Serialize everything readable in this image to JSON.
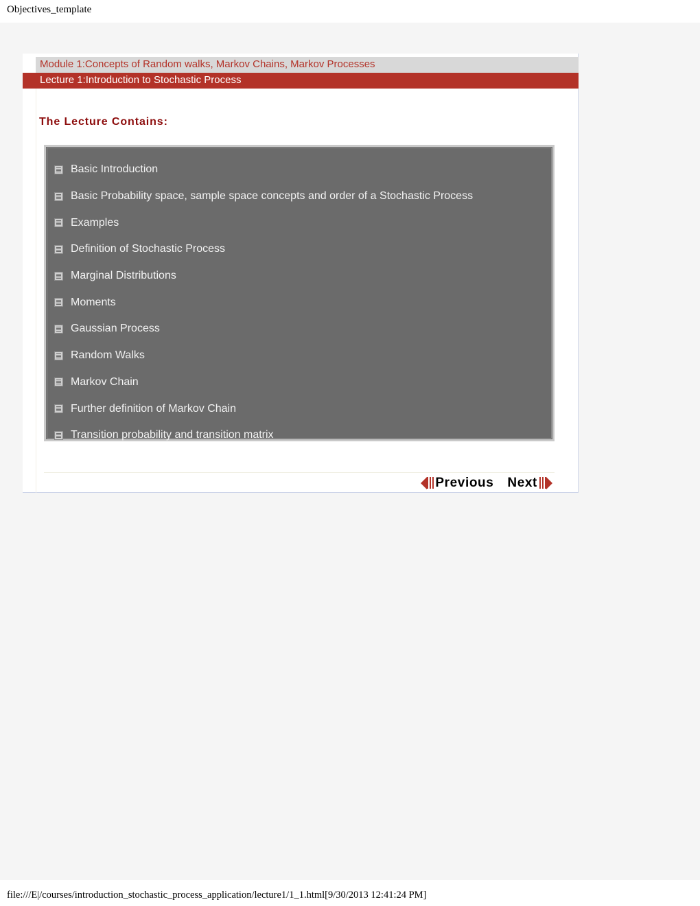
{
  "document": {
    "title": "Objectives_template",
    "footer_path": "file:///E|/courses/introduction_stochastic_process_application/lecture1/1_1.html[9/30/2013 12:41:24 PM]"
  },
  "header": {
    "module": "Module 1:Concepts of Random walks, Markov Chains, Markov Processes",
    "lecture": "Lecture 1:Introduction to Stochastic Process",
    "module_bar_color": "#d8d8d8",
    "module_text_color": "#b33228",
    "lecture_bar_color": "#b33228",
    "lecture_text_color": "#ffffff"
  },
  "content": {
    "heading": "The Lecture Contains:",
    "heading_color": "#8c0b0b",
    "box_bg_color": "#6b6b6b",
    "box_border_color": "#c9c9c9",
    "topics": [
      {
        "label": "Basic Introduction",
        "icon": "document-lines-icon"
      },
      {
        "label": "Basic Probability space, sample space concepts and order of a Stochastic Process",
        "icon": "document-lines-icon"
      },
      {
        "label": "Examples",
        "icon": "document-lines-icon"
      },
      {
        "label": "Definition of Stochastic Process",
        "icon": "document-lines-icon"
      },
      {
        "label": "Marginal Distributions",
        "icon": "document-lines-icon"
      },
      {
        "label": "Moments",
        "icon": "document-lines-icon"
      },
      {
        "label": "Gaussian Process",
        "icon": "document-lines-icon"
      },
      {
        "label": "Random Walks",
        "icon": "document-lines-icon"
      },
      {
        "label": "Markov Chain",
        "icon": "document-lines-icon"
      },
      {
        "label": "Further definition of Markov Chain",
        "icon": "document-lines-icon"
      },
      {
        "label": "Transition probability and transition matrix",
        "icon": "document-lines-icon"
      }
    ]
  },
  "navigation": {
    "previous_label": "Previous",
    "next_label": "Next",
    "arrow_color": "#b33228"
  }
}
